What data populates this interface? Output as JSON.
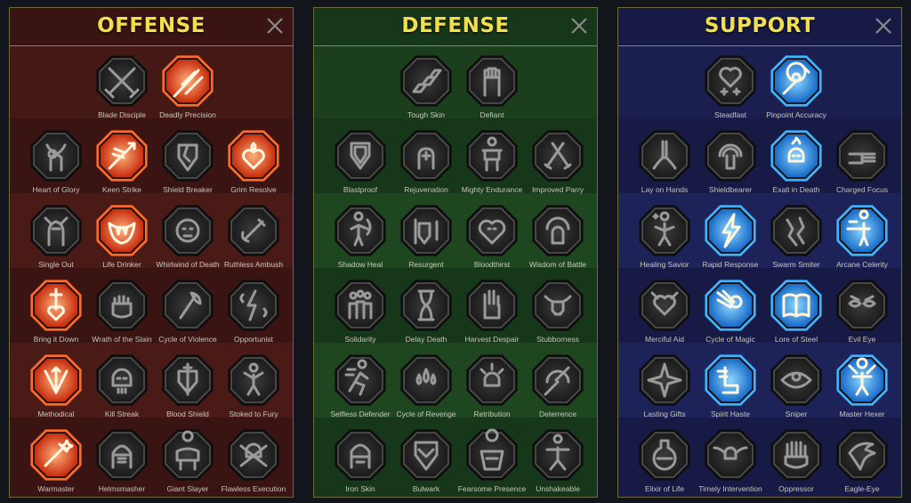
{
  "panels": [
    {
      "key": "offense",
      "title": "OFFENSE",
      "rows": [
        [
          {
            "name": "Blade Disciple",
            "icon": "crossed-swords-icon",
            "active": false
          },
          {
            "name": "Deadly Precision",
            "icon": "piercing-blade-icon",
            "active": true
          }
        ],
        [
          {
            "name": "Heart of Glory",
            "icon": "horned-warrior-icon",
            "active": false
          },
          {
            "name": "Keen Strike",
            "icon": "spear-strike-icon",
            "active": true
          },
          {
            "name": "Shield Breaker",
            "icon": "broken-shield-icon",
            "active": false
          },
          {
            "name": "Grim Resolve",
            "icon": "flaming-heart-icon",
            "active": true
          }
        ],
        [
          {
            "name": "Single Out",
            "icon": "knight-target-icon",
            "active": false
          },
          {
            "name": "Life Drinker",
            "icon": "fanged-mouth-icon",
            "active": true
          },
          {
            "name": "Whirlwind of Death",
            "icon": "whirlwind-skull-icon",
            "active": false
          },
          {
            "name": "Ruthless Ambush",
            "icon": "ambush-dagger-icon",
            "active": false
          }
        ],
        [
          {
            "name": "Bring it Down",
            "icon": "sword-heart-icon",
            "active": true
          },
          {
            "name": "Wrath of the Slain",
            "icon": "fist-icon",
            "active": false
          },
          {
            "name": "Cycle of Violence",
            "icon": "axe-icon",
            "active": false
          },
          {
            "name": "Opportunist",
            "icon": "chained-bolt-icon",
            "active": false
          }
        ],
        [
          {
            "name": "Methodical",
            "icon": "arrow-burst-icon",
            "active": true
          },
          {
            "name": "Kill Streak",
            "icon": "skull-icon",
            "active": false
          },
          {
            "name": "Blood Shield",
            "icon": "sword-shield-icon",
            "active": false
          },
          {
            "name": "Stoked to Fury",
            "icon": "raging-figure-icon",
            "active": false
          }
        ],
        [
          {
            "name": "Warmaster",
            "icon": "sword-sparkle-icon",
            "active": true
          },
          {
            "name": "Helmsmasher",
            "icon": "helmet-icon",
            "active": false
          },
          {
            "name": "Giant Slayer",
            "icon": "giant-icon",
            "active": false
          },
          {
            "name": "Flawless Execution",
            "icon": "skull-cross-icon",
            "active": false
          }
        ]
      ]
    },
    {
      "key": "defense",
      "title": "DEFENSE",
      "rows": [
        [
          {
            "name": "Tough Skin",
            "icon": "scales-icon",
            "active": false
          },
          {
            "name": "Defiant",
            "icon": "raised-fist-icon",
            "active": false
          }
        ],
        [
          {
            "name": "Blastproof",
            "icon": "layered-shield-icon",
            "active": false
          },
          {
            "name": "Rejuvenation",
            "icon": "healing-hand-icon",
            "active": false
          },
          {
            "name": "Mighty Endurance",
            "icon": "strongman-icon",
            "active": false
          },
          {
            "name": "Improved Parry",
            "icon": "crossed-blades-icon",
            "active": false
          }
        ],
        [
          {
            "name": "Shadow Heal",
            "icon": "shadow-figure-icon",
            "active": false
          },
          {
            "name": "Resurgent",
            "icon": "knight-shield-icon",
            "active": false
          },
          {
            "name": "Bloodthirst",
            "icon": "heart-skull-icon",
            "active": false
          },
          {
            "name": "Wisdom of Battle",
            "icon": "halo-head-icon",
            "active": false
          }
        ],
        [
          {
            "name": "Solidarity",
            "icon": "group-icon",
            "active": false
          },
          {
            "name": "Delay Death",
            "icon": "hourglass-icon",
            "active": false
          },
          {
            "name": "Harvest Despair",
            "icon": "open-palm-icon",
            "active": false
          },
          {
            "name": "Stubborness",
            "icon": "bull-icon",
            "active": false
          }
        ],
        [
          {
            "name": "Selfless Defender",
            "icon": "runner-icon",
            "active": false
          },
          {
            "name": "Cycle of Revenge",
            "icon": "drops-icon",
            "active": false
          },
          {
            "name": "Retribution",
            "icon": "spiked-skull-icon",
            "active": false
          },
          {
            "name": "Deterrence",
            "icon": "deflect-icon",
            "active": false
          }
        ],
        [
          {
            "name": "Iron Skin",
            "icon": "armored-head-icon",
            "active": false
          },
          {
            "name": "Bulwark",
            "icon": "chevron-shield-icon",
            "active": false
          },
          {
            "name": "Fearsome Presence",
            "icon": "warlord-icon",
            "active": false
          },
          {
            "name": "Unshakeable",
            "icon": "stance-icon",
            "active": false
          }
        ]
      ]
    },
    {
      "key": "support",
      "title": "SUPPORT",
      "rows": [
        [
          {
            "name": "Steadfast",
            "icon": "heart-plus-icon",
            "active": false
          },
          {
            "name": "Pinpoint Accuracy",
            "icon": "target-icon",
            "active": true
          }
        ],
        [
          {
            "name": "Lay on Hands",
            "icon": "praying-hands-icon",
            "active": false
          },
          {
            "name": "Shieldbearer",
            "icon": "ripple-shield-icon",
            "active": false
          },
          {
            "name": "Exalt in Death",
            "icon": "fire-skull-icon",
            "active": true
          },
          {
            "name": "Charged Focus",
            "icon": "hand-beam-icon",
            "active": false
          }
        ],
        [
          {
            "name": "Healing Savior",
            "icon": "healer-icon",
            "active": false
          },
          {
            "name": "Rapid Response",
            "icon": "lightning-icon",
            "active": true
          },
          {
            "name": "Swarm Smiter",
            "icon": "cracks-icon",
            "active": false
          },
          {
            "name": "Arcane Celerity",
            "icon": "speed-figure-icon",
            "active": true
          }
        ],
        [
          {
            "name": "Merciful Aid",
            "icon": "chained-heart-icon",
            "active": false
          },
          {
            "name": "Cycle of Magic",
            "icon": "comet-icon",
            "active": true
          },
          {
            "name": "Lore of Steel",
            "icon": "book-icon",
            "active": true
          },
          {
            "name": "Evil Eye",
            "icon": "glaring-eyes-icon",
            "active": false
          }
        ],
        [
          {
            "name": "Lasting Gifts",
            "icon": "star-compass-icon",
            "active": false
          },
          {
            "name": "Spirit Haste",
            "icon": "winged-boot-icon",
            "active": true
          },
          {
            "name": "Sniper",
            "icon": "eye-icon",
            "active": false
          },
          {
            "name": "Master Hexer",
            "icon": "voodoo-doll-icon",
            "active": true
          }
        ],
        [
          {
            "name": "Elixir of Life",
            "icon": "potion-icon",
            "active": false
          },
          {
            "name": "Timely Intervention",
            "icon": "winged-skull-icon",
            "active": false
          },
          {
            "name": "Oppressor",
            "icon": "crushing-hand-icon",
            "active": false
          },
          {
            "name": "Eagle-Eye",
            "icon": "eagle-icon",
            "active": false
          }
        ]
      ]
    }
  ],
  "colors": {
    "title": "#f3df4e",
    "offense_active": "#ff6a2b",
    "defense_active": "#a4d12a",
    "support_active": "#3fb3ff",
    "inactive": "#8c8c8c"
  }
}
